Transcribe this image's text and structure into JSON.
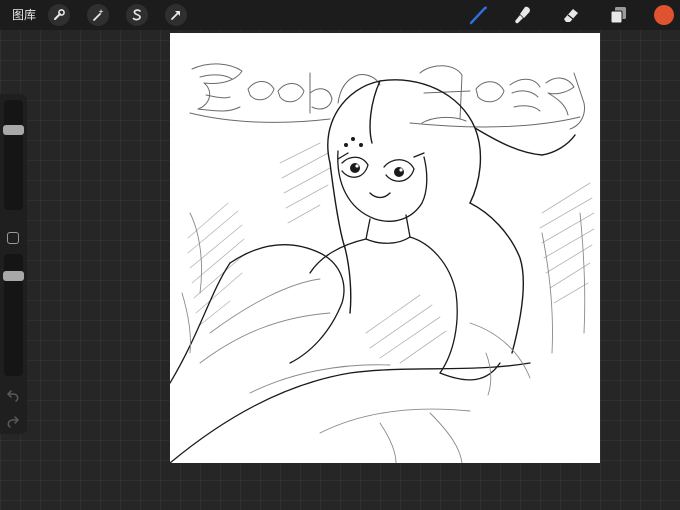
{
  "toolbar": {
    "gallery_label": "图库",
    "left_tools": [
      {
        "icon": "wrench-icon",
        "name": "actions"
      },
      {
        "icon": "magic-wand-icon",
        "name": "adjustments"
      },
      {
        "icon": "selection-s-icon",
        "name": "selection"
      },
      {
        "icon": "arrow-cursor-icon",
        "name": "transform"
      }
    ],
    "right_tools": [
      {
        "icon": "brush-icon",
        "name": "paint",
        "active": true
      },
      {
        "icon": "smudge-icon",
        "name": "smudge"
      },
      {
        "icon": "eraser-icon",
        "name": "erase"
      },
      {
        "icon": "layers-icon",
        "name": "layers"
      }
    ],
    "current_color": "#e0532f",
    "active_tool_color": "#2f6fe0"
  },
  "sidebar": {
    "brush_size_level": 0.75,
    "opacity_level": 0.85
  },
  "colors": {
    "background": "#262626",
    "toolbar": "#1c1c1c",
    "canvas": "#ffffff"
  }
}
